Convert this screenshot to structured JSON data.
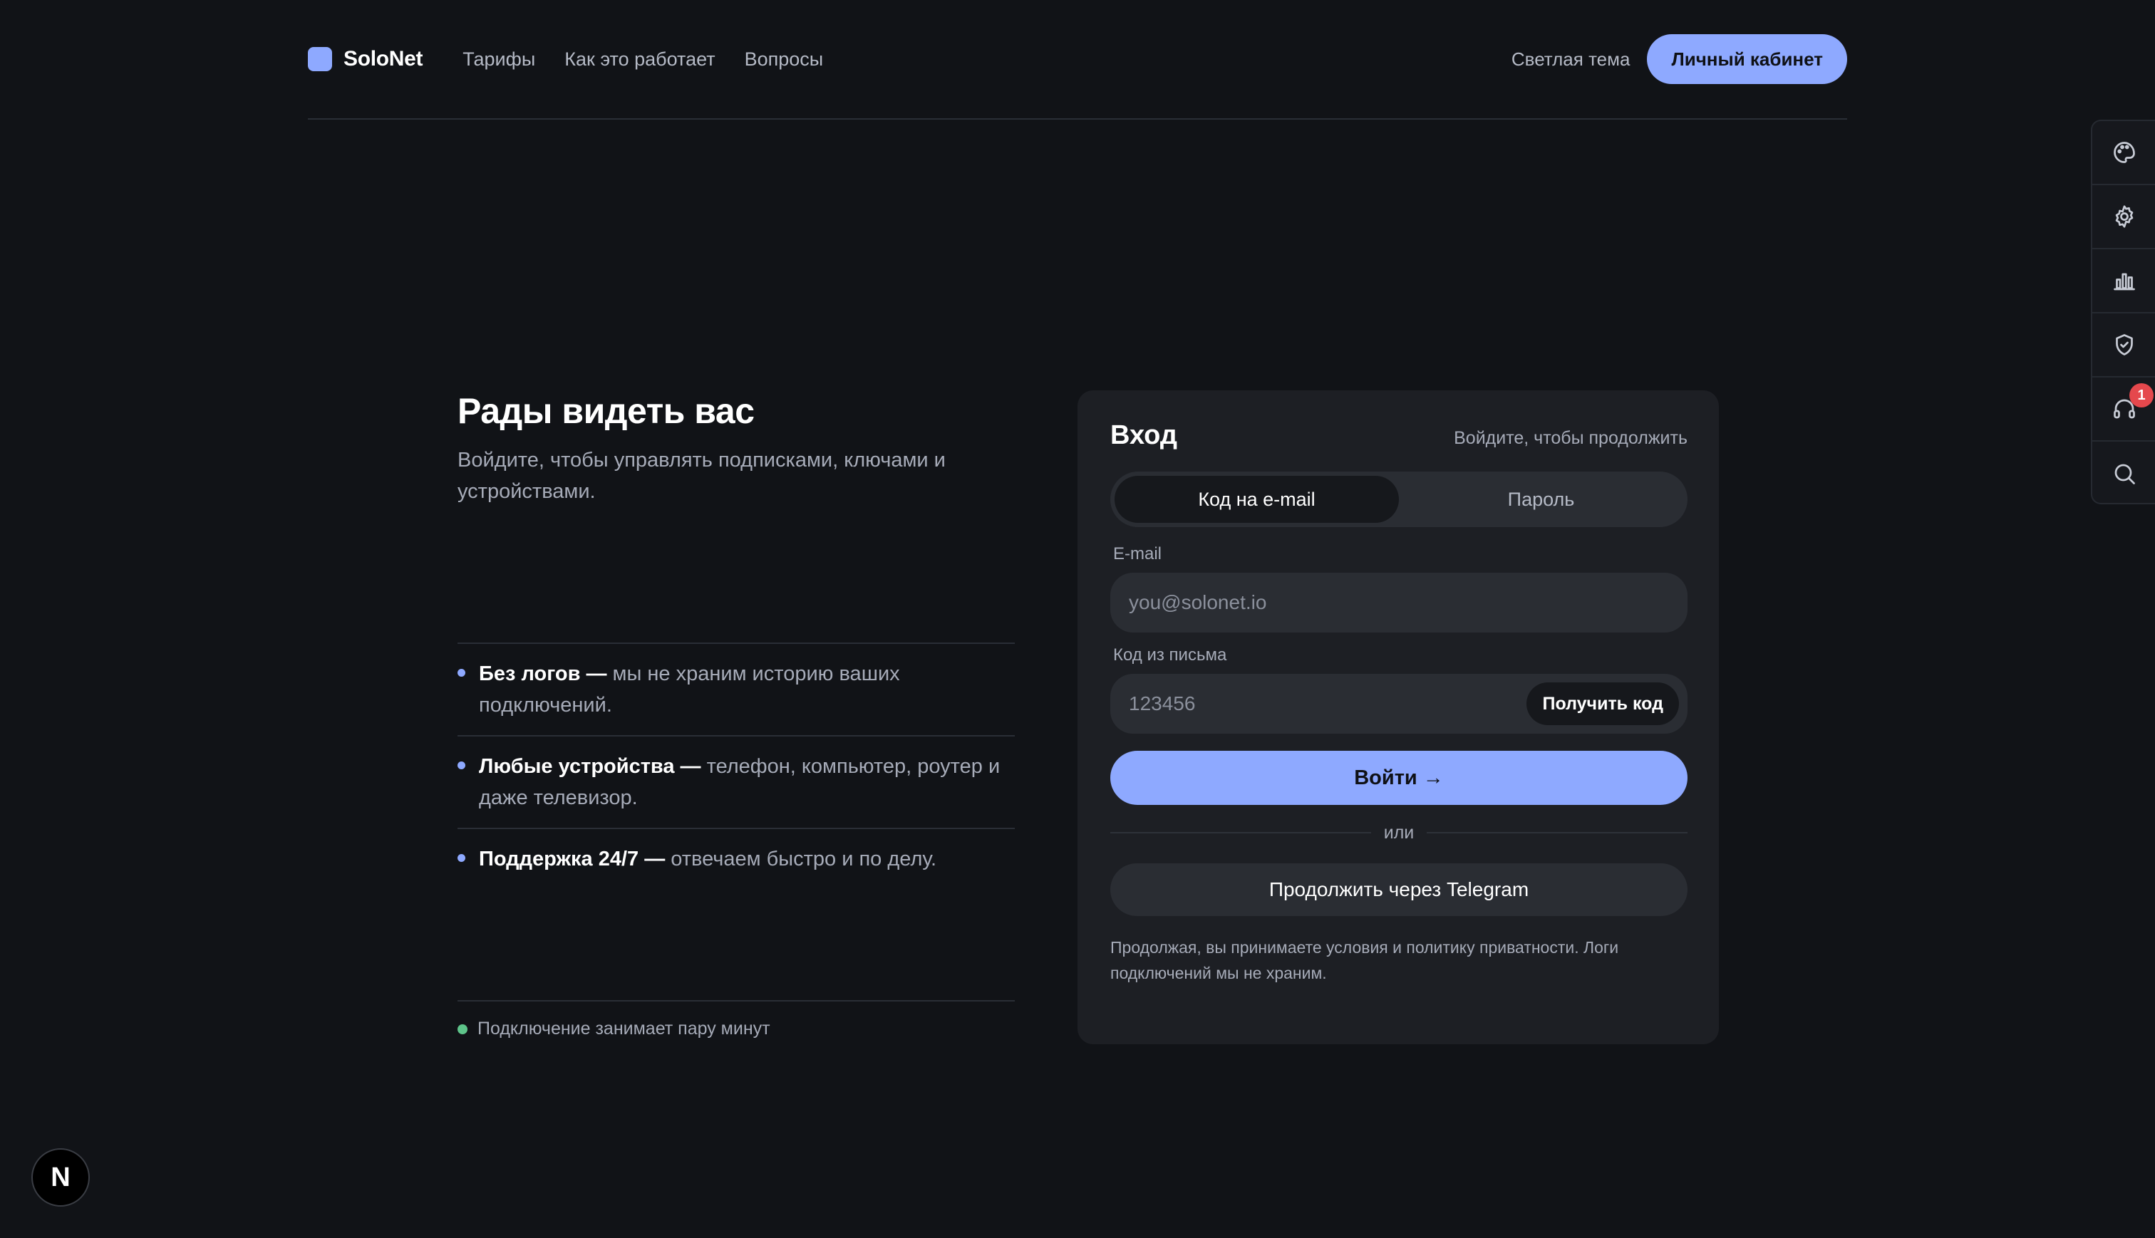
{
  "header": {
    "brand": "SoloNet",
    "nav": [
      "Тарифы",
      "Как это работает",
      "Вопросы"
    ],
    "theme_toggle": "Светлая тема",
    "cabinet_button": "Личный кабинет"
  },
  "tool_rail": {
    "items": [
      "palette-icon",
      "gear-icon",
      "bar-chart-icon",
      "shield-check-icon",
      "headset-icon",
      "search-icon"
    ],
    "support_badge": "1"
  },
  "intro": {
    "title": "Рады видеть вас",
    "subtitle": "Войдите, чтобы управлять подписками, ключами и устройствами."
  },
  "features": [
    {
      "strong": "Без логов —",
      "text": " мы не храним историю ваших подключений."
    },
    {
      "strong": "Любые устройства —",
      "text": " телефон, компьютер, роутер и даже телевизор."
    },
    {
      "strong": "Поддержка 24/7 —",
      "text": " отвечаем быстро и по делу."
    }
  ],
  "status": {
    "text": "Подключение занимает пару минут",
    "color": "#5ec48a"
  },
  "login": {
    "title": "Вход",
    "hint": "Войдите, чтобы продолжить",
    "tabs": [
      "Код на e-mail",
      "Пароль"
    ],
    "active_tab": "Код на e-mail",
    "email_label": "E-mail",
    "email_placeholder": "you@solonet.io",
    "code_label": "Код из письма",
    "code_placeholder": "123456",
    "get_code_button": "Получить код",
    "submit_button": "Войти →",
    "divider": "или",
    "telegram_button": "Продолжить через Telegram",
    "legal": "Продолжая, вы принимаете условия и политику приватности. Логи подключений мы не храним."
  },
  "dev_badge": "N",
  "colors": {
    "accent": "#8ea9ff",
    "background": "#111317",
    "card": "#1d1f24"
  }
}
